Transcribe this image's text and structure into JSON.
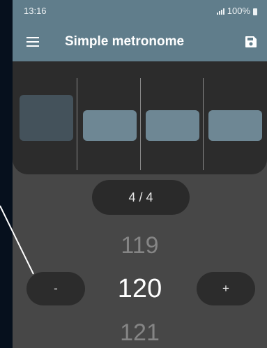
{
  "status": {
    "time": "13:16",
    "battery": "100%"
  },
  "appbar": {
    "title": "Simple metronome"
  },
  "beats": {
    "count": 4,
    "active_index": 0
  },
  "time_signature": "4 / 4",
  "tempo": {
    "previous": "119",
    "current": "120",
    "next": "121"
  },
  "buttons": {
    "minus": "-",
    "plus": "+"
  },
  "colors": {
    "primary": "#607d8b",
    "background": "#474747",
    "beat": "#6e8794",
    "active_beat": "#44525b",
    "panel": "#2c2c2c"
  },
  "icons": [
    "menu-icon",
    "save-icon",
    "signal-icon",
    "battery-icon"
  ]
}
